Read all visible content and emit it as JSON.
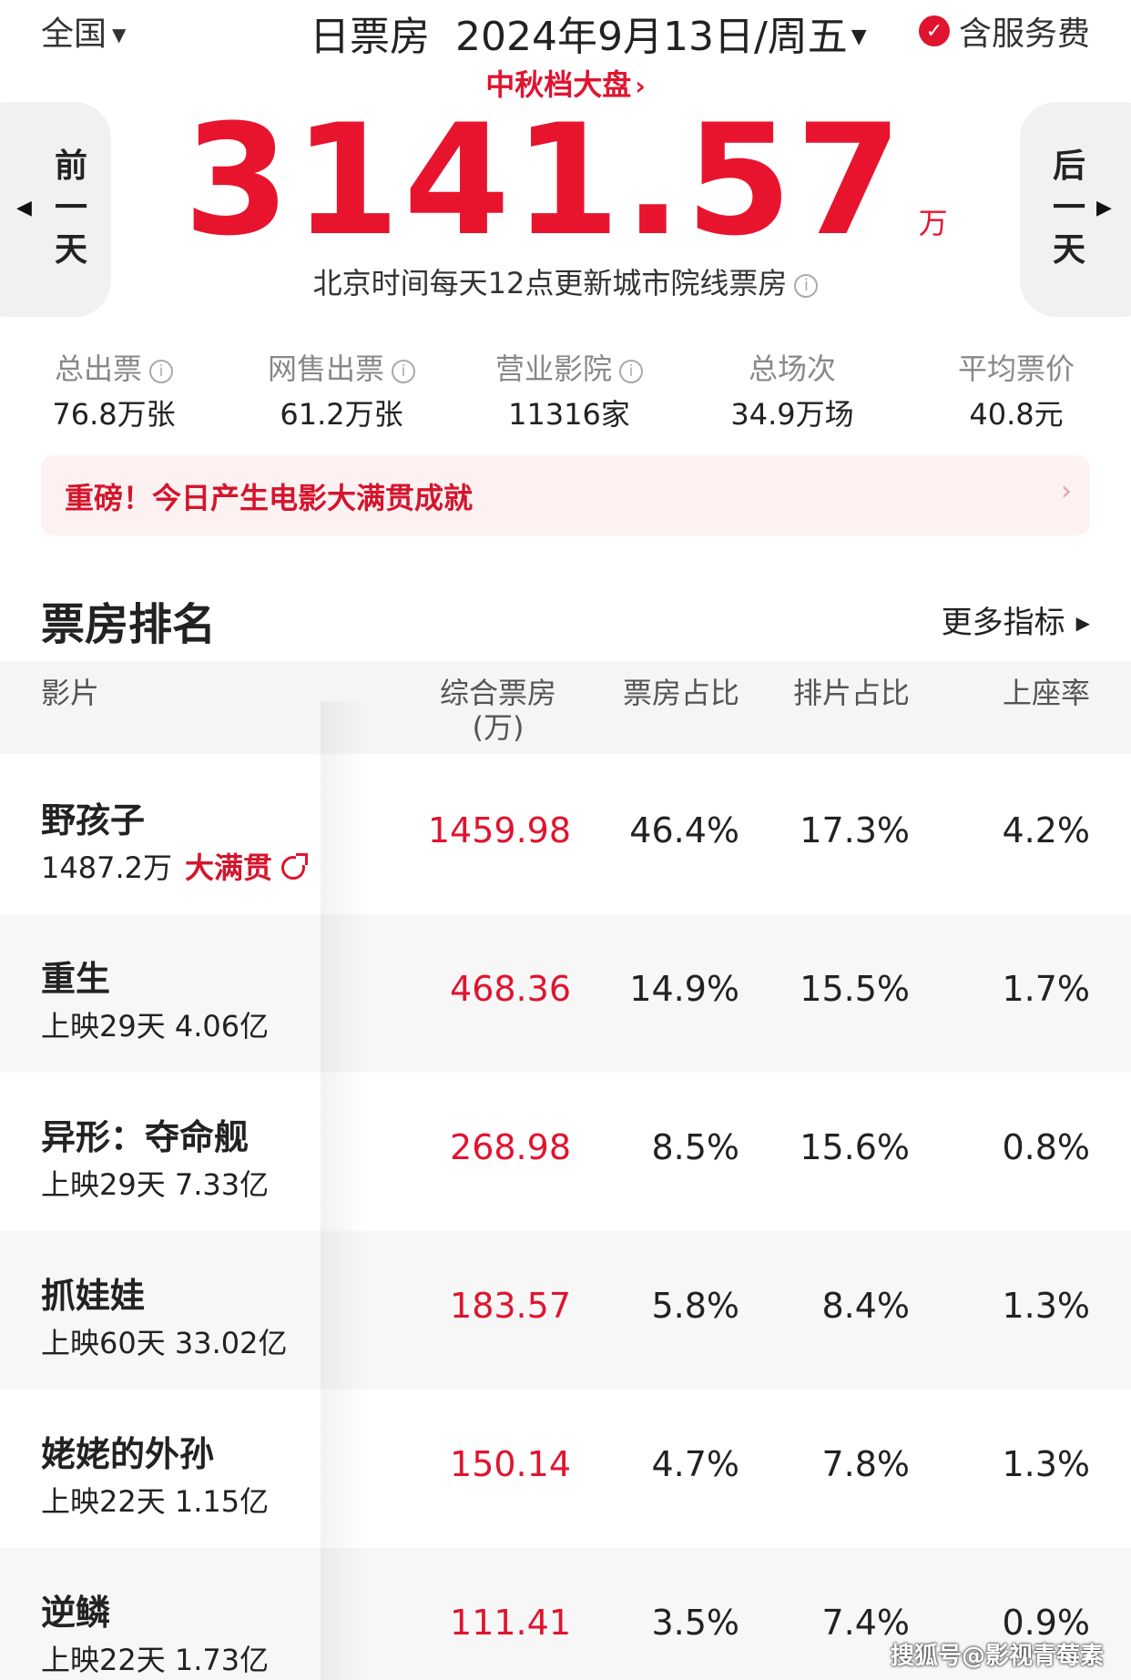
{
  "header": {
    "region": "全国",
    "title": "日票房",
    "date": "2024年9月13日/周五",
    "service_fee": "含服务费",
    "festival_link": "中秋档大盘",
    "total_box": "3141.57",
    "total_unit": "万",
    "update_note": "北京时间每天12点更新城市院线票房",
    "prev_day": [
      "前",
      "一",
      "天"
    ],
    "next_day": [
      "后",
      "一",
      "天"
    ]
  },
  "stats": [
    {
      "label": "总出票",
      "value": "76.8万张",
      "info": true
    },
    {
      "label": "网售出票",
      "value": "61.2万张",
      "info": true
    },
    {
      "label": "营业影院",
      "value": "11316家",
      "info": true
    },
    {
      "label": "总场次",
      "value": "34.9万场",
      "info": false
    },
    {
      "label": "平均票价",
      "value": "40.8元",
      "info": false
    }
  ],
  "banner": {
    "text": "重磅！今日产生电影大满贯成就",
    "chevron": "›"
  },
  "ranking": {
    "title": "票房排名",
    "more": "更多指标",
    "columns": {
      "film": "影片",
      "box_line1": "综合票房",
      "box_line2": "(万)",
      "share": "票房占比",
      "schedule": "排片占比",
      "seat": "上座率"
    },
    "rows": [
      {
        "name": "野孩子",
        "sub": "1487.2万",
        "tag": "大满贯",
        "box": "1459.98",
        "share": "46.4%",
        "schedule": "17.3%",
        "seat": "4.2%"
      },
      {
        "name": "重生",
        "sub": "上映29天 4.06亿",
        "tag": "",
        "box": "468.36",
        "share": "14.9%",
        "schedule": "15.5%",
        "seat": "1.7%"
      },
      {
        "name": "异形：夺命舰",
        "sub": "上映29天 7.33亿",
        "tag": "",
        "box": "268.98",
        "share": "8.5%",
        "schedule": "15.6%",
        "seat": "0.8%"
      },
      {
        "name": "抓娃娃",
        "sub": "上映60天 33.02亿",
        "tag": "",
        "box": "183.57",
        "share": "5.8%",
        "schedule": "8.4%",
        "seat": "1.3%"
      },
      {
        "name": "姥姥的外孙",
        "sub": "上映22天 1.15亿",
        "tag": "",
        "box": "150.14",
        "share": "4.7%",
        "schedule": "7.8%",
        "seat": "1.3%"
      },
      {
        "name": "逆鳞",
        "sub": "上映22天 1.73亿",
        "tag": "",
        "box": "111.41",
        "share": "3.5%",
        "schedule": "7.4%",
        "seat": "0.9%"
      }
    ]
  },
  "watermark": "搜狐号@影视青莓素"
}
